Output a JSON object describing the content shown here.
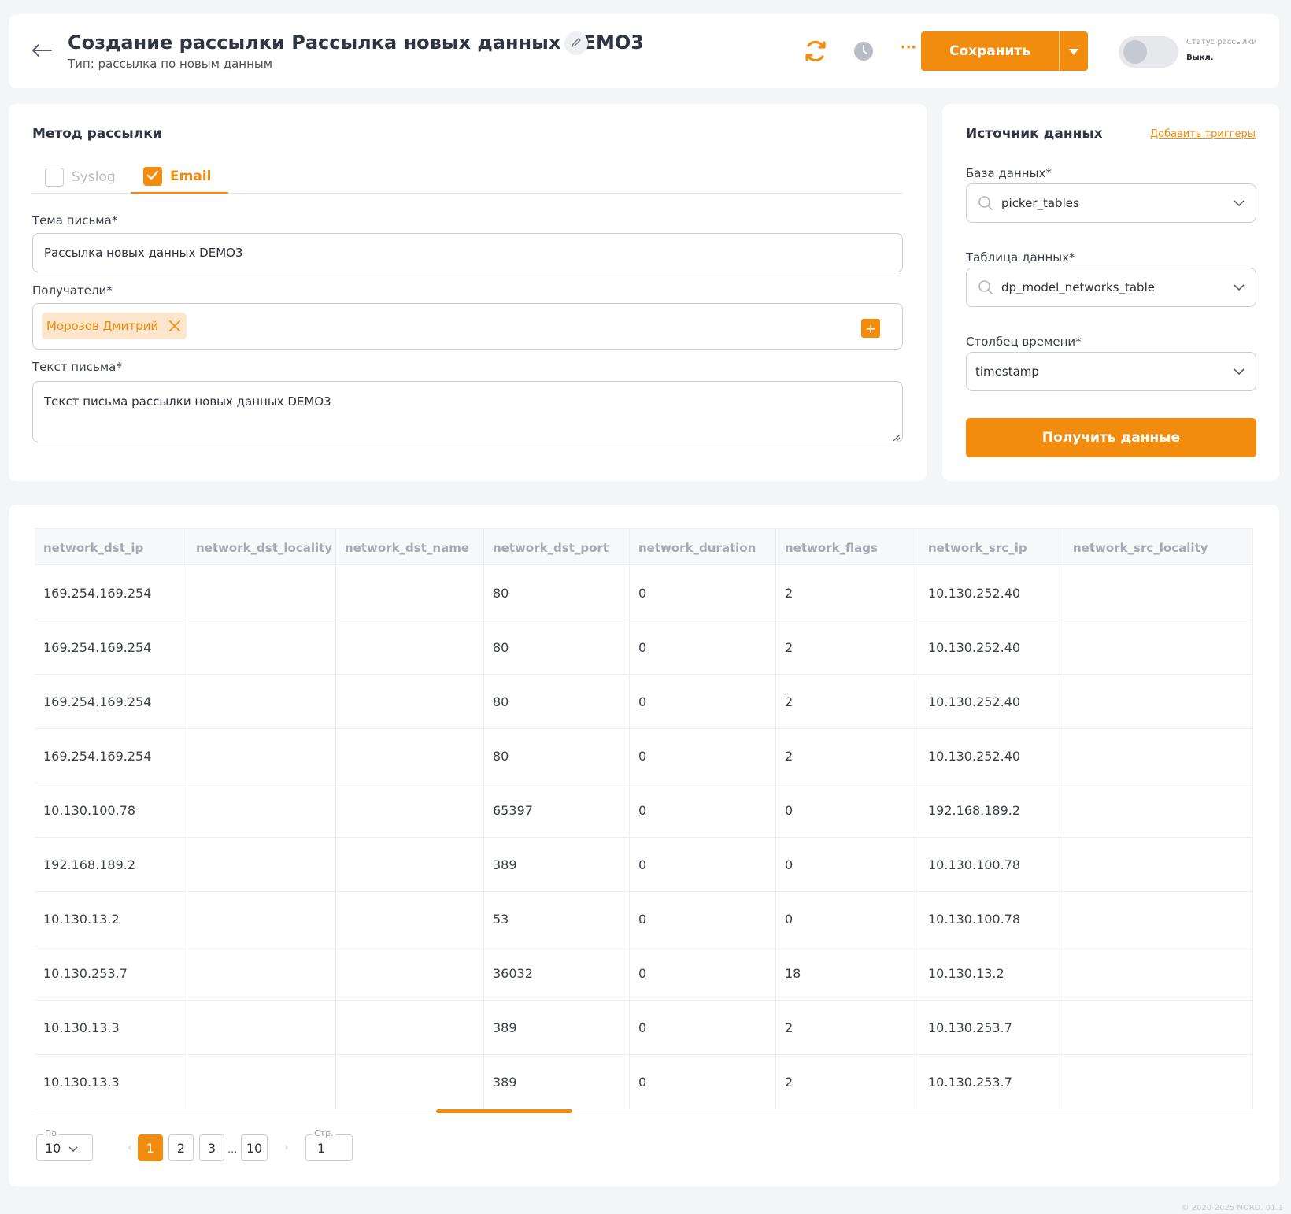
{
  "header": {
    "title": "Создание рассылки Рассылка новых данных DEMO3",
    "subtitle": "Тип: рассылка по новым данным",
    "save_label": "Сохранить",
    "more_label": "···",
    "status_label": "Статус рассылки",
    "status_value": "Выкл."
  },
  "method": {
    "title": "Метод рассылки",
    "tabs": [
      {
        "label": "Syslog",
        "checked": false
      },
      {
        "label": "Email",
        "checked": true
      }
    ],
    "subject_label": "Тема письма*",
    "subject_value": "Рассылка новых данных DEMO3",
    "recipients_label": "Получатели*",
    "recipients": [
      "Морозов Дмитрий"
    ],
    "add_label": "+",
    "body_label": "Текст письма*",
    "body_value": "Текст письма рассылки новых данных DEMO3"
  },
  "source": {
    "title": "Источник данных",
    "add_triggers": "Добавить триггеры",
    "db_label": "База данных*",
    "db_value": "picker_tables",
    "table_label": "Таблица данных*",
    "table_value": "dp_model_networks_table",
    "time_label": "Столбец времени*",
    "time_value": "timestamp",
    "get_label": "Получить данные"
  },
  "table": {
    "columns": [
      "network_dst_ip",
      "network_dst_locality",
      "network_dst_name",
      "network_dst_port",
      "network_duration",
      "network_flags",
      "network_src_ip",
      "network_src_locality"
    ],
    "rows": [
      [
        "169.254.169.254",
        "",
        "",
        "80",
        "0",
        "2",
        "10.130.252.40",
        ""
      ],
      [
        "169.254.169.254",
        "",
        "",
        "80",
        "0",
        "2",
        "10.130.252.40",
        ""
      ],
      [
        "169.254.169.254",
        "",
        "",
        "80",
        "0",
        "2",
        "10.130.252.40",
        ""
      ],
      [
        "169.254.169.254",
        "",
        "",
        "80",
        "0",
        "2",
        "10.130.252.40",
        ""
      ],
      [
        "10.130.100.78",
        "",
        "",
        "65397",
        "0",
        "0",
        "192.168.189.2",
        ""
      ],
      [
        "192.168.189.2",
        "",
        "",
        "389",
        "0",
        "0",
        "10.130.100.78",
        ""
      ],
      [
        "10.130.13.2",
        "",
        "",
        "53",
        "0",
        "0",
        "10.130.100.78",
        ""
      ],
      [
        "10.130.253.7",
        "",
        "",
        "36032",
        "0",
        "18",
        "10.130.13.2",
        ""
      ],
      [
        "10.130.13.3",
        "",
        "",
        "389",
        "0",
        "2",
        "10.130.253.7",
        ""
      ],
      [
        "10.130.13.3",
        "",
        "",
        "389",
        "0",
        "2",
        "10.130.253.7",
        ""
      ]
    ]
  },
  "pagination": {
    "per_page_label": "По",
    "per_page_value": "10",
    "pages": [
      "1",
      "2",
      "3",
      "10"
    ],
    "active_page": "1",
    "ellipsis": "...",
    "prev": "‹",
    "next": "›",
    "page_label": "Стр.",
    "page_value": "1"
  },
  "footer": {
    "note": "© 2020-2025 NORD. 01.1"
  },
  "colors": {
    "accent": "#f28c0f",
    "chip_bg": "#fde6cc"
  }
}
